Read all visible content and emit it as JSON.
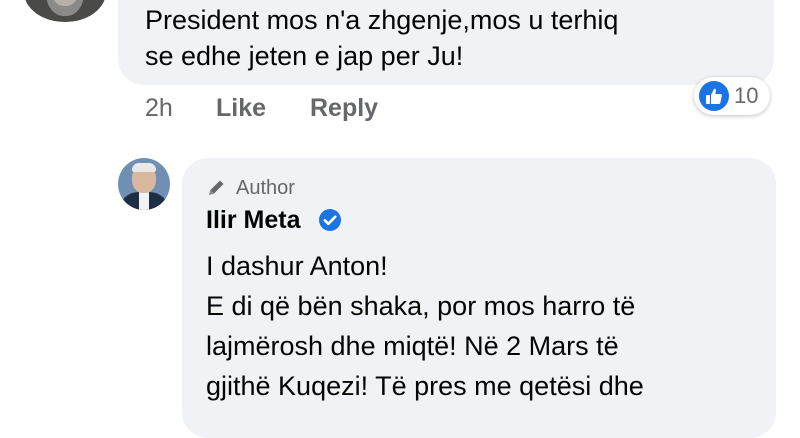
{
  "comment": {
    "lines": [
      "President mos n'a zhgenje,mos u terhiq",
      "se edhe jeten e jap per Ju!"
    ],
    "actions": {
      "time": "2h",
      "like": "Like",
      "reply": "Reply"
    },
    "reactions": {
      "icon": "thumbs-up-icon",
      "count": "10",
      "color": "#1b74e4"
    }
  },
  "reply": {
    "badge": "Author",
    "badge_icon": "pencil-icon",
    "author": "Ilir Meta",
    "verified_icon": "verified-badge-icon",
    "lines": [
      "I dashur Anton!",
      "E di që bën shaka, por mos harro të",
      "lajmërosh dhe miqtë! Në 2 Mars të",
      "gjithë Kuqezi! Të pres me qetësi dhe"
    ]
  },
  "colors": {
    "bubble": "#f0f2f5",
    "secondary_text": "#65676b",
    "accent": "#1b74e4"
  }
}
